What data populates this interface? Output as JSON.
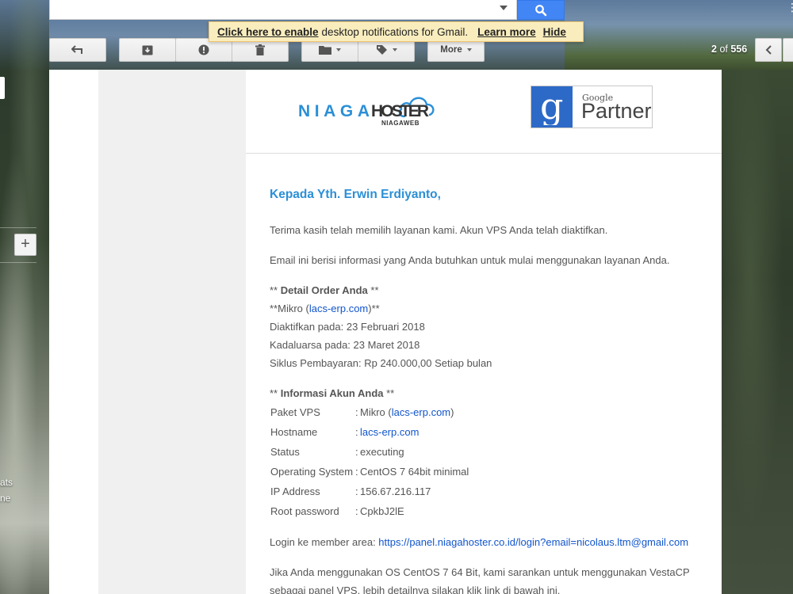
{
  "search": {
    "placeholder": ""
  },
  "notification": {
    "enable_link": "Click here to enable",
    "message": "desktop notifications for Gmail.",
    "learn_more": "Learn more",
    "hide": "Hide"
  },
  "toolbar": {
    "more_label": "More",
    "pager_prefix": "2",
    "pager_of": "of",
    "pager_total": "556"
  },
  "left_sidebar": {
    "text_1": "ats",
    "text_2": "ne"
  },
  "email": {
    "logo": {
      "brand": "NIAGAHOSTER",
      "sub": "NIAGAWEB"
    },
    "google_partner": {
      "google": "Google",
      "partner": "Partner"
    },
    "greeting": "Kepada Yth. Erwin Erdiyanto,",
    "intro_1": "Terima kasih telah memilih layanan kami. Akun VPS Anda telah diaktifkan.",
    "intro_2": "Email ini berisi informasi yang Anda butuhkan untuk mulai menggunakan layanan Anda.",
    "order_heading_pre": "** ",
    "order_heading": "Detail Order Anda",
    "order_heading_post": " **",
    "order_line_1_pre": "**Mikro (",
    "order_line_1_link": "lacs-erp.com",
    "order_line_1_post": ")**",
    "order_line_2": "Diaktifkan pada: 23 Februari 2018",
    "order_line_3": "Kadaluarsa pada: 23 Maret 2018",
    "order_line_4": "Siklus Pembayaran: Rp 240.000,00 Setiap bulan",
    "account_heading_pre": "** ",
    "account_heading": "Informasi Akun Anda",
    "account_heading_post": " **",
    "account_rows": [
      {
        "key": "Paket VPS",
        "sep": ":",
        "value_pre": "Mikro (",
        "value_link": "lacs-erp.com",
        "value_post": ")"
      },
      {
        "key": "Hostname",
        "sep": ":",
        "value_link": "lacs-erp.com"
      },
      {
        "key": "Status",
        "sep": ":",
        "value": "executing"
      },
      {
        "key": "Operating System",
        "sep": ":",
        "value": "CentOS 7 64bit minimal"
      },
      {
        "key": "IP Address",
        "sep": ":",
        "value": "156.67.216.117"
      },
      {
        "key": "Root password",
        "sep": ":",
        "value": "CpkbJ2lE"
      }
    ],
    "login_label": "Login ke member area: ",
    "login_link": "https://panel.niagahoster.co.id/login?email=nicolaus.ltm@gmail.com",
    "vesta_line_1": "Jika Anda menggunakan OS CentOS 7 64 Bit, kami sarankan untuk menggunakan VestaCP",
    "vesta_line_2": "sebagai panel VPS, lebih detailnya silakan klik link di bawah ini."
  }
}
